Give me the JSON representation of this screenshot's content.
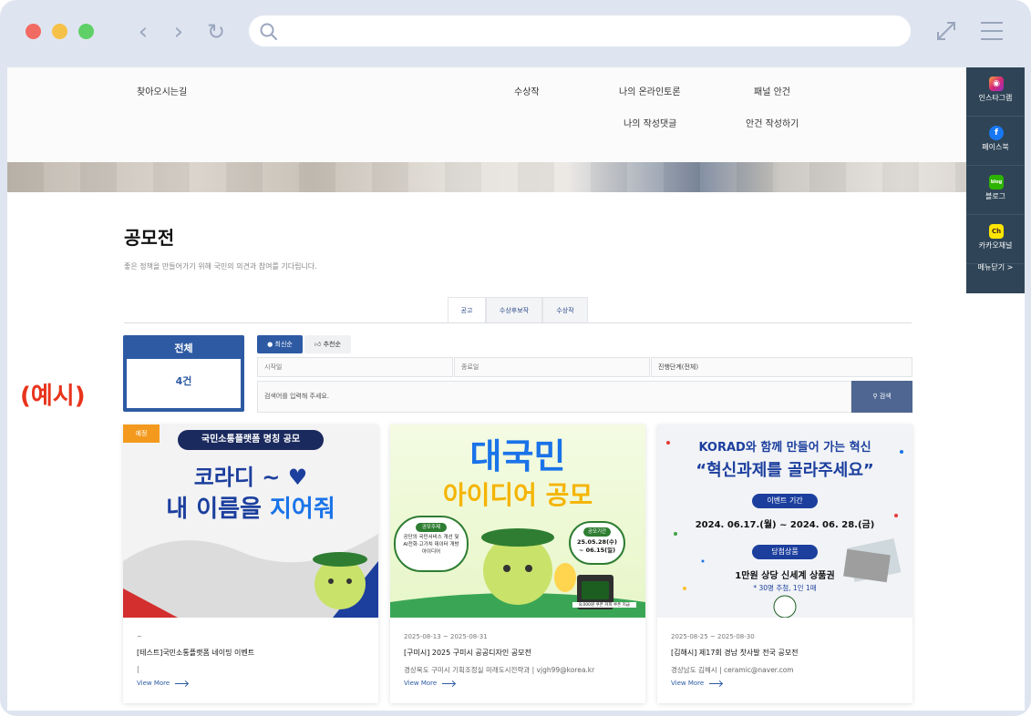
{
  "header": {
    "menu": [
      "찾아오시는길",
      "수상작",
      "나의 온라인토론",
      "패널 안건",
      "나의 작성댓글",
      "안건 작성하기"
    ]
  },
  "sidebar": {
    "items": [
      "인스타그램",
      "페이스북",
      "블로그",
      "카카오채널"
    ],
    "close_label": "메뉴닫기 >"
  },
  "page": {
    "title": "공모전",
    "subtitle": "좋은 정책을 만들어가기 위해 국민의 의견과 참여를 기다립니다."
  },
  "tabs": [
    "공고",
    "수상후보작",
    "수상작"
  ],
  "total": {
    "label": "전체",
    "count": "4건"
  },
  "sort": {
    "latest": "최신순",
    "recommended": "추천순"
  },
  "filters": {
    "start_date": "시작일",
    "end_date": "종료일",
    "stage": "진행단계(전체)"
  },
  "search": {
    "placeholder": "검색어를 입력해 주세요.",
    "button": "검색"
  },
  "example_label": "(예시)",
  "cards": [
    {
      "badge": "예정",
      "poster_banner": "국민소통플랫폼 명칭 공모",
      "poster_line1": "코라디 ~ ♥",
      "poster_line2a": "내 이름을 ",
      "poster_line2b": "지어줘",
      "date": "~",
      "title": "[테스트]국민소통플랫폼 네이밍 이벤트",
      "meta": "|",
      "more": "View More"
    },
    {
      "poster_line1": "대국민",
      "poster_line2": "아이디어 공모",
      "bubble_left_title": "공모주제",
      "bubble_left_text": "공단의 국민서비스 개선 및 AI전화·고가치 데이터 개방 아이디어",
      "bubble_right_title": "공모기간",
      "bubble_right_text": "25.05.28(수) ~ 06.15(일)",
      "gift": "8,000원 쿠폰 커피 쿠폰 지급",
      "date": "2025-08-13 ~ 2025-08-31",
      "title": "[구미시] 2025 구미시 공공디자인 공모전",
      "meta": "경상북도 구미시 기획조정실 미래도시전략과  |  vjgh99@korea.kr",
      "more": "View More"
    },
    {
      "poster_line1": "KORAD와 함께 만들어 가는 혁신",
      "poster_line2": "“혁신과제를 골라주세요”",
      "pill1": "이벤트 기간",
      "period": "2024. 06.17.(월) ~ 2024. 06. 28.(금)",
      "pill2": "당첨상품",
      "prize": "1만원 상당 신세계 상품권",
      "prize_note": "* 30명 추첨, 1인 1매",
      "date": "2025-08-25 ~ 2025-08-30",
      "title": "[김해시] 제17회 경남 찻사발 전국 공모전",
      "meta": "경상남도 김해시  |  ceramic@naver.com",
      "more": "View More"
    }
  ],
  "colors": {
    "primary": "#2d5aa3",
    "sidebar": "#2f4557",
    "example": "#e8341c",
    "badge": "#f39a1e"
  }
}
